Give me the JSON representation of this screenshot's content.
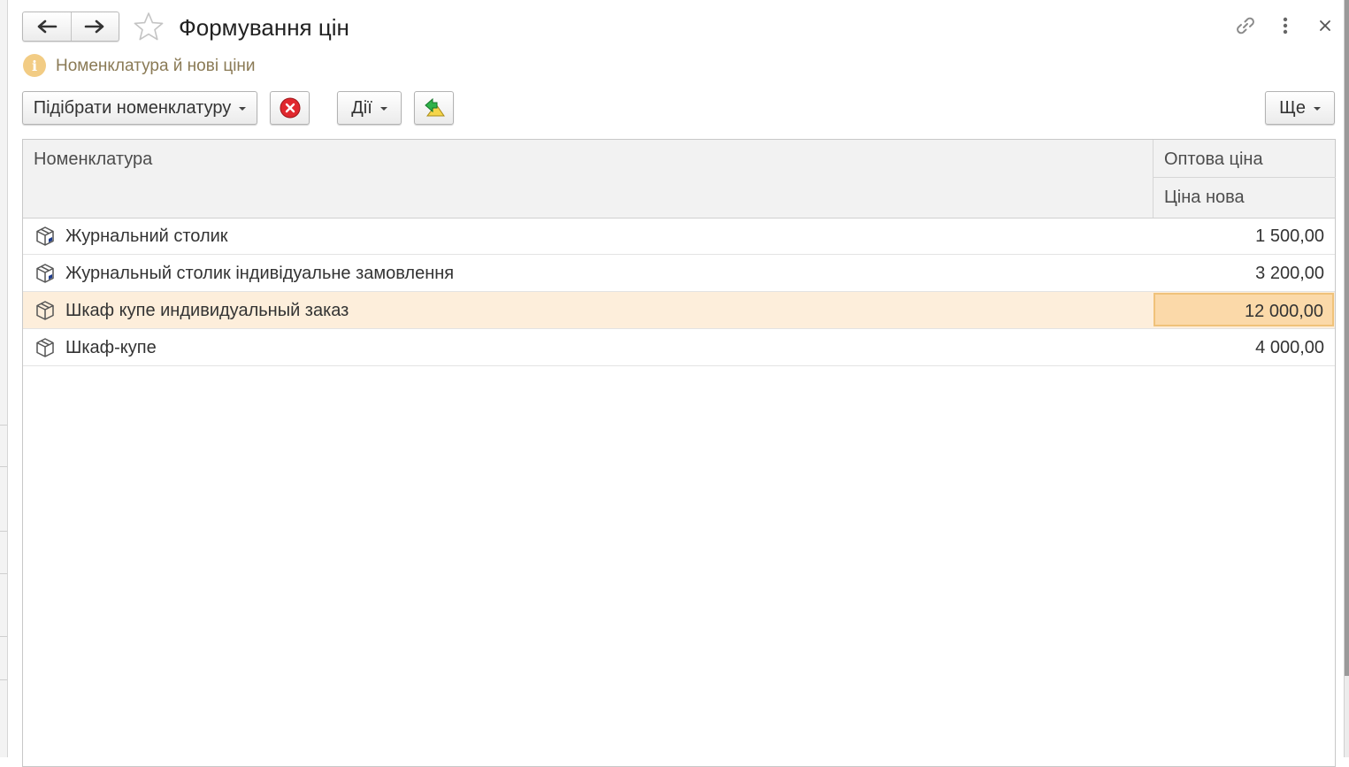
{
  "window": {
    "title": "Формування цін",
    "info_text": "Номенклатура й нові ціни"
  },
  "toolbar": {
    "pick_label": "Підібрати номенклатуру",
    "actions_label": "Дії",
    "more_label": "Ще"
  },
  "table": {
    "columns": {
      "name": "Номенклатура",
      "wholesale_price": "Оптова ціна",
      "new_price": "Ціна нова"
    },
    "rows": [
      {
        "name": "Журнальний столик",
        "price": "1 500,00"
      },
      {
        "name": "Журнальный столик індивідуальне замовлення",
        "price": "3 200,00"
      },
      {
        "name": "Шкаф купе индивидуальный заказ",
        "price": "12 000,00"
      },
      {
        "name": "Шкаф-купе",
        "price": "4 000,00"
      }
    ],
    "selected_row": 2
  },
  "icons": {
    "back": "arrow-left-icon",
    "forward": "arrow-right-icon",
    "favorite": "star-icon",
    "link": "link-icon",
    "menu": "more-vertical-icon",
    "close": "close-icon",
    "info": "info-icon",
    "delete": "delete-icon",
    "export": "export-icon",
    "item": "product-box-icon"
  },
  "colors": {
    "selected_row": "#fdeedb",
    "selected_cell": "#fbd9a9",
    "info": "#f2cc84",
    "delete": "#e0282e"
  }
}
